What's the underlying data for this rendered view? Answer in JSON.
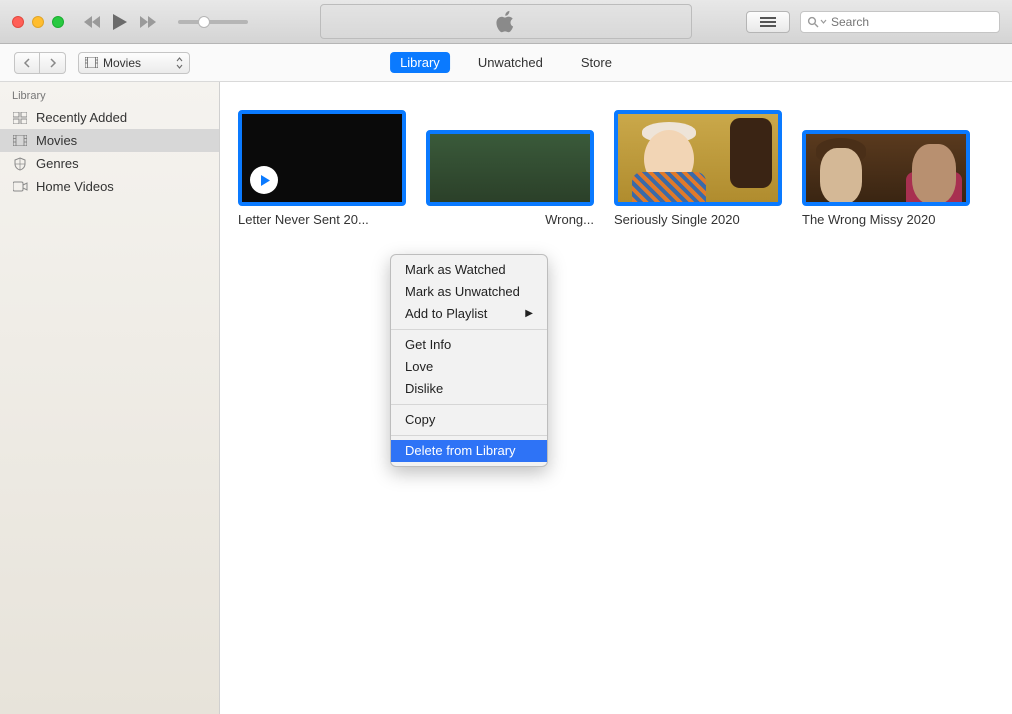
{
  "search": {
    "placeholder": "Search"
  },
  "category": {
    "label": "Movies"
  },
  "tabs": {
    "library": "Library",
    "unwatched": "Unwatched",
    "store": "Store"
  },
  "sidebar": {
    "header": "Library",
    "items": [
      {
        "label": "Recently Added"
      },
      {
        "label": "Movies"
      },
      {
        "label": "Genres"
      },
      {
        "label": "Home Videos"
      }
    ]
  },
  "movies": [
    {
      "title": "Letter Never Sent 20..."
    },
    {
      "title": "Wrong..."
    },
    {
      "title": "Seriously Single 2020"
    },
    {
      "title": "The Wrong Missy 2020"
    }
  ],
  "context_menu": {
    "mark_watched": "Mark as Watched",
    "mark_unwatched": "Mark as Unwatched",
    "add_playlist": "Add to Playlist",
    "get_info": "Get Info",
    "love": "Love",
    "dislike": "Dislike",
    "copy": "Copy",
    "delete": "Delete from Library"
  }
}
